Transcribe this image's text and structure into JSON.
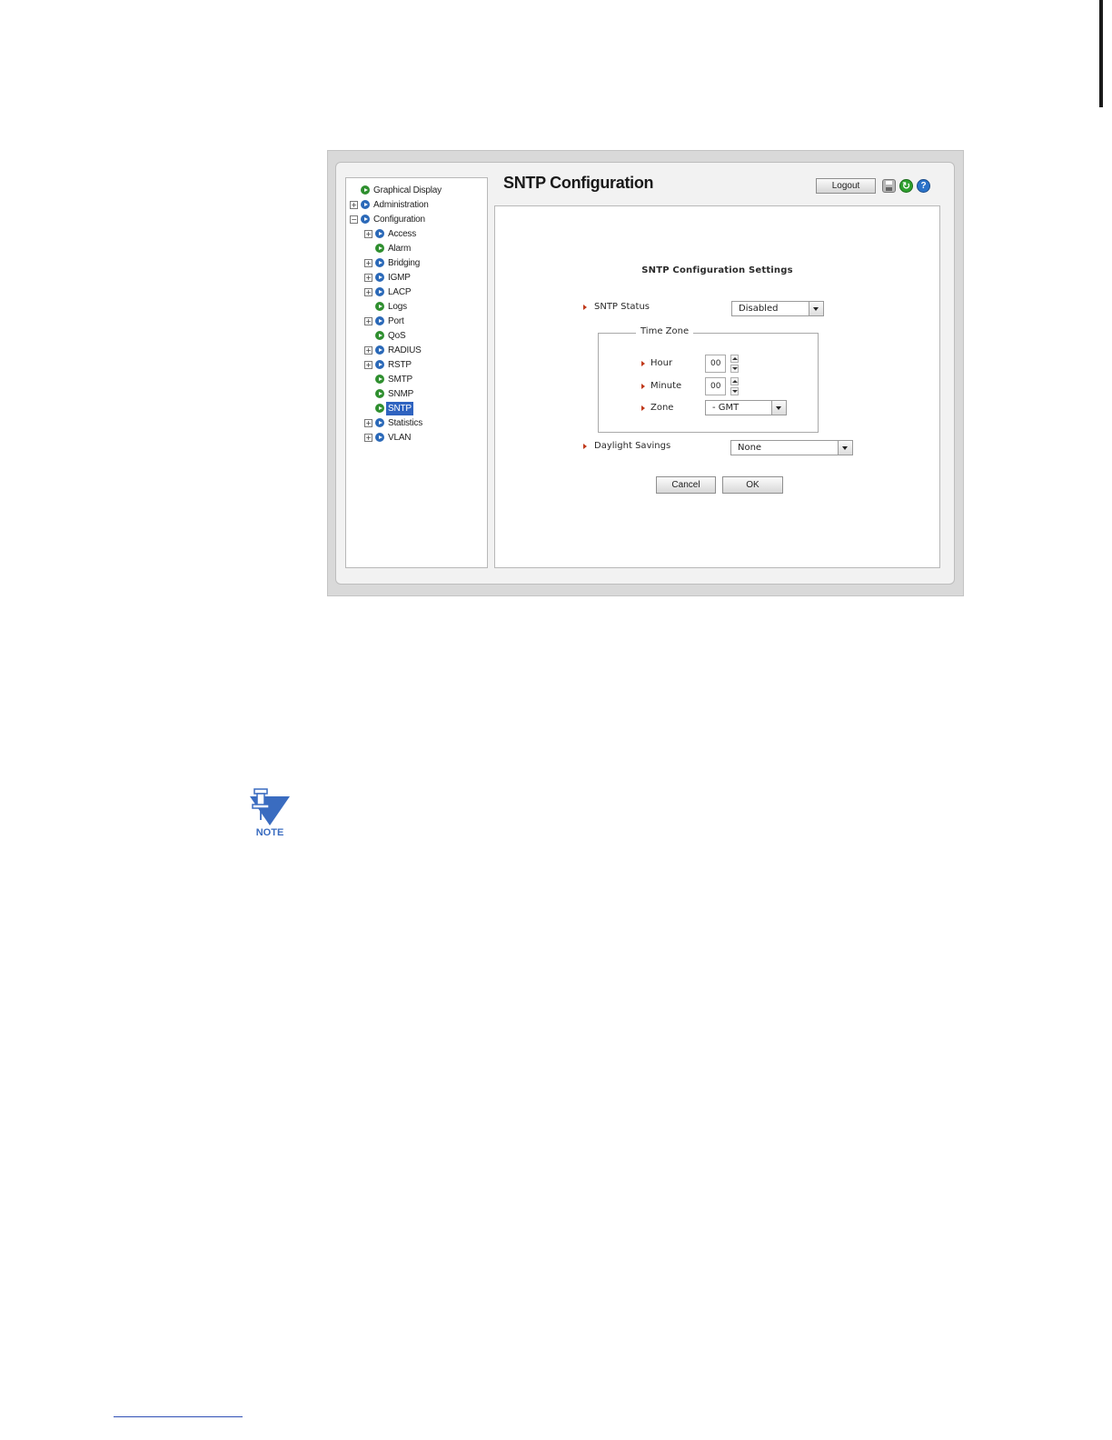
{
  "app": {
    "title": "SNTP Configuration",
    "logout_label": "Logout"
  },
  "icons": {
    "save": "save-icon",
    "refresh": "refresh-icon",
    "help": "help-icon"
  },
  "nav": {
    "items": [
      {
        "label": "Graphical Display",
        "bullet": "green"
      },
      {
        "label": "Administration",
        "bullet": "blue",
        "expander": "+"
      },
      {
        "label": "Configuration",
        "bullet": "blue",
        "expander": "−"
      },
      {
        "label": "Access",
        "bullet": "blue",
        "expander": "+"
      },
      {
        "label": "Alarm",
        "bullet": "green"
      },
      {
        "label": "Bridging",
        "bullet": "blue",
        "expander": "+"
      },
      {
        "label": "IGMP",
        "bullet": "blue",
        "expander": "+"
      },
      {
        "label": "LACP",
        "bullet": "blue",
        "expander": "+"
      },
      {
        "label": "Logs",
        "bullet": "green"
      },
      {
        "label": "Port",
        "bullet": "blue",
        "expander": "+"
      },
      {
        "label": "QoS",
        "bullet": "green"
      },
      {
        "label": "RADIUS",
        "bullet": "blue",
        "expander": "+"
      },
      {
        "label": "RSTP",
        "bullet": "blue",
        "expander": "+"
      },
      {
        "label": "SMTP",
        "bullet": "green"
      },
      {
        "label": "SNMP",
        "bullet": "green"
      },
      {
        "label": "SNTP",
        "bullet": "green",
        "selected": true
      },
      {
        "label": "Statistics",
        "bullet": "blue",
        "expander": "+"
      },
      {
        "label": "VLAN",
        "bullet": "blue",
        "expander": "+"
      }
    ]
  },
  "form": {
    "heading": "SNTP Configuration Settings",
    "sntp_status": {
      "label": "SNTP Status",
      "value": "Disabled"
    },
    "time_zone": {
      "legend": "Time Zone",
      "hour": {
        "label": "Hour",
        "value": "00"
      },
      "minute": {
        "label": "Minute",
        "value": "00"
      },
      "zone": {
        "label": "Zone",
        "value": "- GMT"
      }
    },
    "daylight_savings": {
      "label": "Daylight Savings",
      "value": "None"
    },
    "cancel_label": "Cancel",
    "ok_label": "OK"
  },
  "note": {
    "label": "NOTE"
  }
}
